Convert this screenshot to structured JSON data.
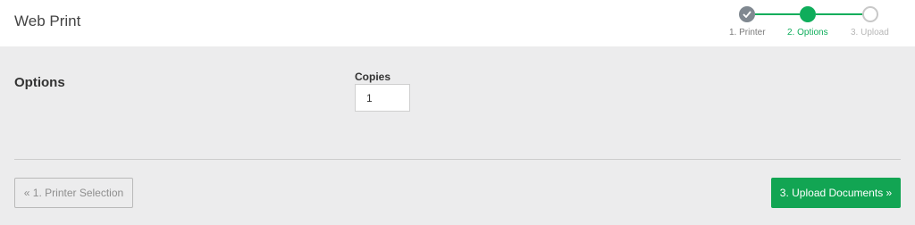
{
  "header": {
    "title": "Web Print"
  },
  "stepper": {
    "steps": [
      {
        "label": "1. Printer",
        "state": "complete"
      },
      {
        "label": "2. Options",
        "state": "active"
      },
      {
        "label": "3. Upload",
        "state": "pending"
      }
    ],
    "colors": {
      "active": "#0fad5b",
      "complete": "#808890",
      "pending": "#c8c8c8"
    }
  },
  "options": {
    "section_title": "Options",
    "copies_label": "Copies",
    "copies_value": "1"
  },
  "footer": {
    "back_label": "« 1. Printer Selection",
    "next_label": "3. Upload Documents »"
  }
}
